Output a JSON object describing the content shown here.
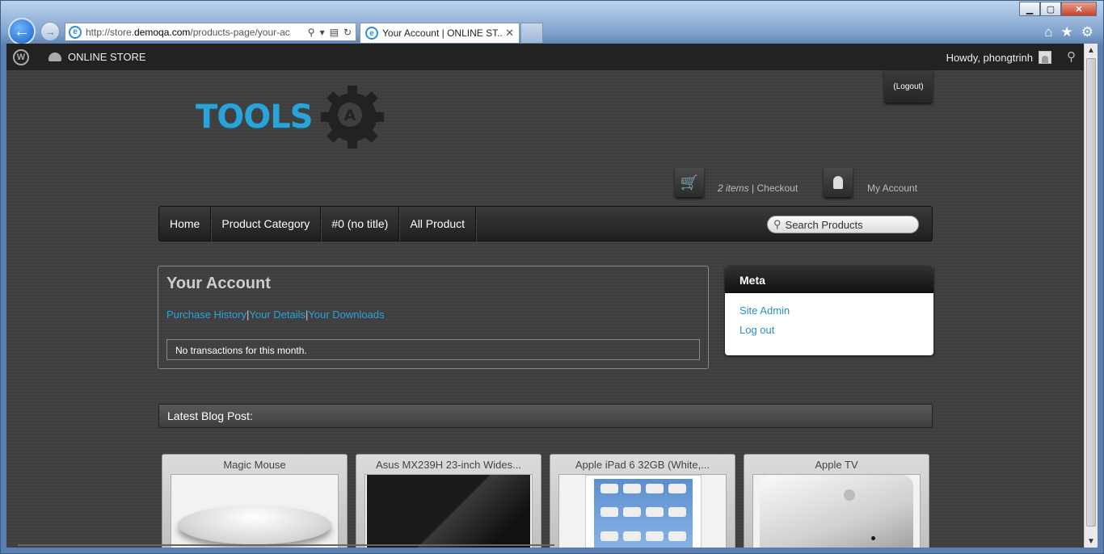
{
  "browser": {
    "back_glyph": "←",
    "forward_glyph": "→",
    "address_prefix": "http://store.",
    "address_domain": "demoqa.com",
    "address_rest": "/products-page/your-ac",
    "tab_title": "Your Account | ONLINE ST...",
    "tab_close": "✕",
    "window_minimize": "▁",
    "window_maximize": "▢",
    "window_close": "✕"
  },
  "adminbar": {
    "site_name": "ONLINE STORE",
    "howdy": "Howdy, phongtrinh"
  },
  "header": {
    "logo_text": "TOOLS",
    "logout": "(Logout)",
    "cart_count": "2 items",
    "cart_sep": " | ",
    "checkout": "Checkout",
    "my_account": "My Account"
  },
  "nav": {
    "items": [
      "Home",
      "Product Category",
      "#0 (no title)",
      "All Product"
    ],
    "search_placeholder": "Search Products"
  },
  "account": {
    "title": "Your Account",
    "links": [
      "Purchase History",
      "Your Details",
      "Your Downloads"
    ],
    "separator": "|",
    "notice": "No transactions for this month."
  },
  "meta": {
    "title": "Meta",
    "links": [
      "Site Admin",
      "Log out"
    ]
  },
  "blog": {
    "title": "Latest Blog Post:"
  },
  "products": [
    {
      "title": "Magic Mouse"
    },
    {
      "title": "Asus MX239H 23-inch Wides..."
    },
    {
      "title": "Apple iPad 6 32GB (White,..."
    },
    {
      "title": "Apple TV"
    }
  ],
  "colors": {
    "accent": "#2aa3d9",
    "page_bg": "#3f3f3f",
    "adminbar_bg": "#222222"
  }
}
